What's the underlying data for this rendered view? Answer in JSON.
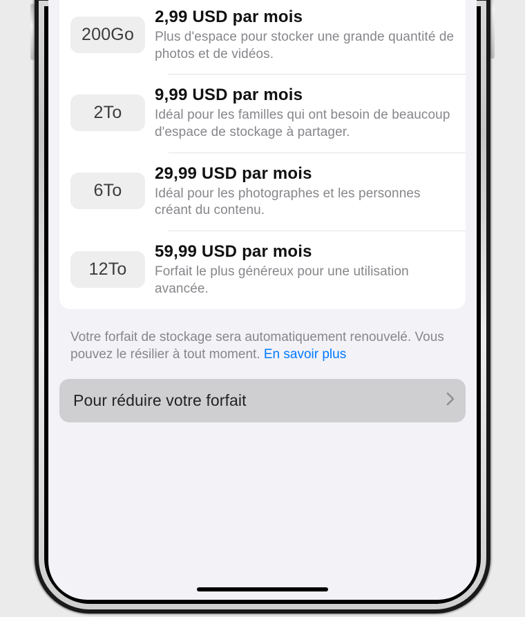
{
  "plans": [
    {
      "size": "200Go",
      "price": "2,99 USD par mois",
      "desc": "Plus d'espace pour stocker une grande quantité de photos et de vidéos."
    },
    {
      "size": "2To",
      "price": "9,99 USD par mois",
      "desc": "Idéal pour les familles qui ont besoin de beaucoup d'espace de stockage à partager."
    },
    {
      "size": "6To",
      "price": "29,99 USD par mois",
      "desc": "Idéal pour les photographes et les personnes créant du contenu."
    },
    {
      "size": "12To",
      "price": "59,99 USD par mois",
      "desc": "Forfait le plus généreux pour une utilisation avancée."
    }
  ],
  "footnote": {
    "text": "Votre forfait de stockage sera automatiquement renouvelé. Vous pouvez le résilier à tout moment. ",
    "link": "En savoir plus"
  },
  "reduce_label": "Pour réduire votre forfait"
}
